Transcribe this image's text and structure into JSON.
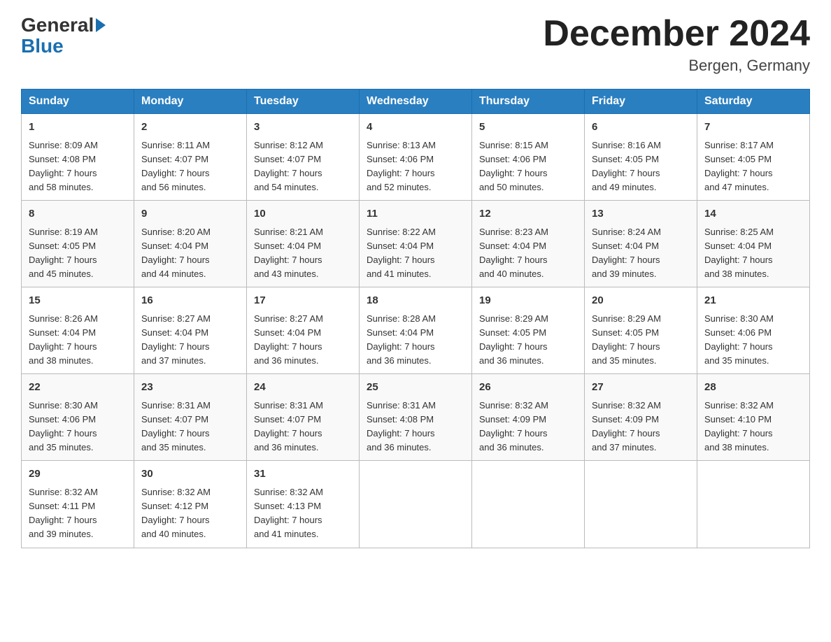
{
  "header": {
    "logo_general": "General",
    "logo_blue": "Blue",
    "month_title": "December 2024",
    "location": "Bergen, Germany"
  },
  "days_of_week": [
    "Sunday",
    "Monday",
    "Tuesday",
    "Wednesday",
    "Thursday",
    "Friday",
    "Saturday"
  ],
  "weeks": [
    [
      {
        "day": "1",
        "sunrise": "8:09 AM",
        "sunset": "4:08 PM",
        "daylight": "7 hours and 58 minutes."
      },
      {
        "day": "2",
        "sunrise": "8:11 AM",
        "sunset": "4:07 PM",
        "daylight": "7 hours and 56 minutes."
      },
      {
        "day": "3",
        "sunrise": "8:12 AM",
        "sunset": "4:07 PM",
        "daylight": "7 hours and 54 minutes."
      },
      {
        "day": "4",
        "sunrise": "8:13 AM",
        "sunset": "4:06 PM",
        "daylight": "7 hours and 52 minutes."
      },
      {
        "day": "5",
        "sunrise": "8:15 AM",
        "sunset": "4:06 PM",
        "daylight": "7 hours and 50 minutes."
      },
      {
        "day": "6",
        "sunrise": "8:16 AM",
        "sunset": "4:05 PM",
        "daylight": "7 hours and 49 minutes."
      },
      {
        "day": "7",
        "sunrise": "8:17 AM",
        "sunset": "4:05 PM",
        "daylight": "7 hours and 47 minutes."
      }
    ],
    [
      {
        "day": "8",
        "sunrise": "8:19 AM",
        "sunset": "4:05 PM",
        "daylight": "7 hours and 45 minutes."
      },
      {
        "day": "9",
        "sunrise": "8:20 AM",
        "sunset": "4:04 PM",
        "daylight": "7 hours and 44 minutes."
      },
      {
        "day": "10",
        "sunrise": "8:21 AM",
        "sunset": "4:04 PM",
        "daylight": "7 hours and 43 minutes."
      },
      {
        "day": "11",
        "sunrise": "8:22 AM",
        "sunset": "4:04 PM",
        "daylight": "7 hours and 41 minutes."
      },
      {
        "day": "12",
        "sunrise": "8:23 AM",
        "sunset": "4:04 PM",
        "daylight": "7 hours and 40 minutes."
      },
      {
        "day": "13",
        "sunrise": "8:24 AM",
        "sunset": "4:04 PM",
        "daylight": "7 hours and 39 minutes."
      },
      {
        "day": "14",
        "sunrise": "8:25 AM",
        "sunset": "4:04 PM",
        "daylight": "7 hours and 38 minutes."
      }
    ],
    [
      {
        "day": "15",
        "sunrise": "8:26 AM",
        "sunset": "4:04 PM",
        "daylight": "7 hours and 38 minutes."
      },
      {
        "day": "16",
        "sunrise": "8:27 AM",
        "sunset": "4:04 PM",
        "daylight": "7 hours and 37 minutes."
      },
      {
        "day": "17",
        "sunrise": "8:27 AM",
        "sunset": "4:04 PM",
        "daylight": "7 hours and 36 minutes."
      },
      {
        "day": "18",
        "sunrise": "8:28 AM",
        "sunset": "4:04 PM",
        "daylight": "7 hours and 36 minutes."
      },
      {
        "day": "19",
        "sunrise": "8:29 AM",
        "sunset": "4:05 PM",
        "daylight": "7 hours and 36 minutes."
      },
      {
        "day": "20",
        "sunrise": "8:29 AM",
        "sunset": "4:05 PM",
        "daylight": "7 hours and 35 minutes."
      },
      {
        "day": "21",
        "sunrise": "8:30 AM",
        "sunset": "4:06 PM",
        "daylight": "7 hours and 35 minutes."
      }
    ],
    [
      {
        "day": "22",
        "sunrise": "8:30 AM",
        "sunset": "4:06 PM",
        "daylight": "7 hours and 35 minutes."
      },
      {
        "day": "23",
        "sunrise": "8:31 AM",
        "sunset": "4:07 PM",
        "daylight": "7 hours and 35 minutes."
      },
      {
        "day": "24",
        "sunrise": "8:31 AM",
        "sunset": "4:07 PM",
        "daylight": "7 hours and 36 minutes."
      },
      {
        "day": "25",
        "sunrise": "8:31 AM",
        "sunset": "4:08 PM",
        "daylight": "7 hours and 36 minutes."
      },
      {
        "day": "26",
        "sunrise": "8:32 AM",
        "sunset": "4:09 PM",
        "daylight": "7 hours and 36 minutes."
      },
      {
        "day": "27",
        "sunrise": "8:32 AM",
        "sunset": "4:09 PM",
        "daylight": "7 hours and 37 minutes."
      },
      {
        "day": "28",
        "sunrise": "8:32 AM",
        "sunset": "4:10 PM",
        "daylight": "7 hours and 38 minutes."
      }
    ],
    [
      {
        "day": "29",
        "sunrise": "8:32 AM",
        "sunset": "4:11 PM",
        "daylight": "7 hours and 39 minutes."
      },
      {
        "day": "30",
        "sunrise": "8:32 AM",
        "sunset": "4:12 PM",
        "daylight": "7 hours and 40 minutes."
      },
      {
        "day": "31",
        "sunrise": "8:32 AM",
        "sunset": "4:13 PM",
        "daylight": "7 hours and 41 minutes."
      },
      null,
      null,
      null,
      null
    ]
  ],
  "labels": {
    "sunrise": "Sunrise:",
    "sunset": "Sunset:",
    "daylight": "Daylight:"
  }
}
